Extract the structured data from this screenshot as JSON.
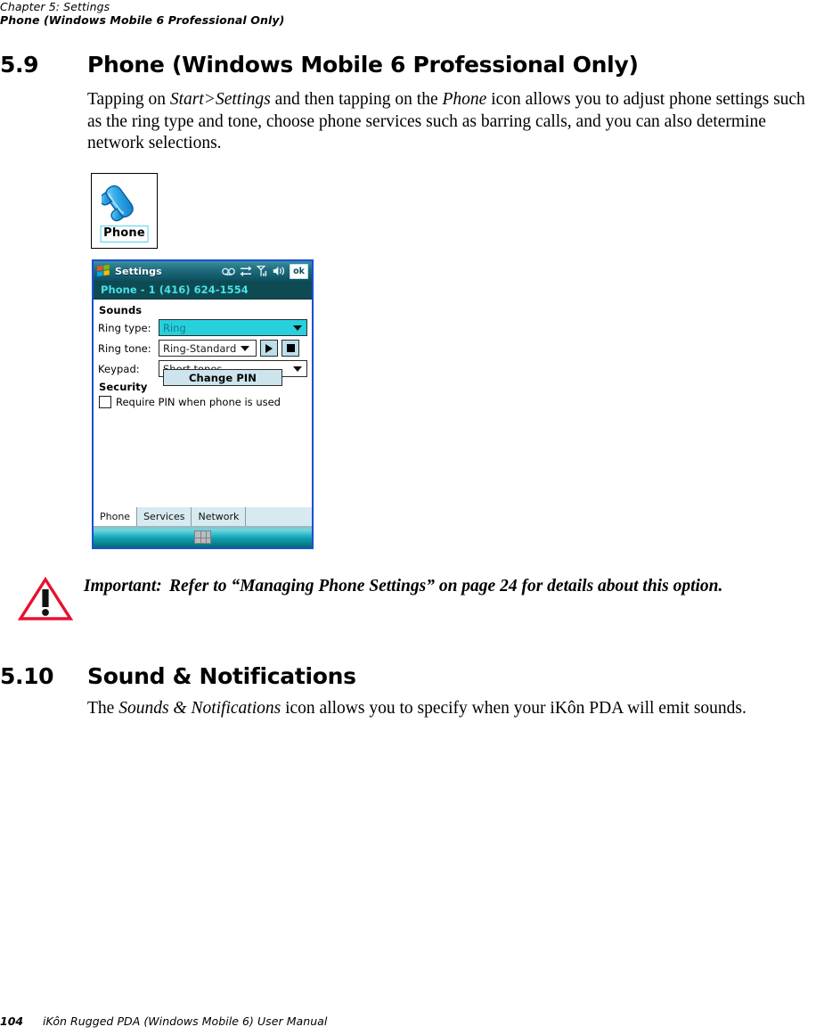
{
  "running_head": {
    "line1": "Chapter 5:  Settings",
    "line2": "Phone (Windows Mobile 6 Professional Only)"
  },
  "sections": [
    {
      "number": "5.9",
      "title": "Phone (Windows Mobile 6 Professional Only)",
      "paragraph_plain": "Tapping on Start>Settings and then tapping on the Phone icon allows you to adjust phone settings such as the ring type and tone, choose phone services such as barring calls, and you can also determine network selections.",
      "paragraph_parts": {
        "p1": "Tapping on ",
        "em1": "Start>Settings",
        "p2": " and then tapping on the ",
        "em2": "Phone",
        "p3": " icon allows you to adjust phone settings such as the ring type and tone, choose phone services such as barring calls, and you can also determine network selections."
      }
    },
    {
      "number": "5.10",
      "title": "Sound & Notifications",
      "paragraph_plain": "The Sounds & Notifications icon allows you to specify when your iKôn PDA will emit sounds.",
      "paragraph_parts": {
        "p1": "The ",
        "em1": "Sounds & Notifications",
        "p2": " icon allows you to specify when your iKôn PDA will emit sounds."
      }
    }
  ],
  "phone_icon_figure": {
    "icon": "phone-handset-icon",
    "caption": "Phone",
    "caption_border_color": "#4fd4e8",
    "handset_color": "#2aa8e0"
  },
  "pda_screenshot": {
    "frame_border_color": "#1a4fd6",
    "titlebar": {
      "start_icon": "windows-flag-icon",
      "title": "Settings",
      "status_icons": [
        "voicemail-icon",
        "connectivity-icon",
        "signal-bars-icon",
        "speaker-icon"
      ],
      "ok_label": "ok",
      "bg_color": "#1e6b7d"
    },
    "subbar": {
      "text": "Phone - 1 (416) 624-1554",
      "text_color": "#4ae0e8",
      "bg_color": "#0e4a52"
    },
    "groups": [
      {
        "label": "Sounds",
        "fields": [
          {
            "label": "Ring type:",
            "value": "Ring",
            "control": "combobox",
            "selected": true
          },
          {
            "label": "Ring tone:",
            "value": "Ring-Standard",
            "control": "combobox",
            "selected": false,
            "buttons": [
              {
                "name": "play-button",
                "glyph": "play-icon"
              },
              {
                "name": "stop-button",
                "glyph": "stop-icon"
              }
            ]
          },
          {
            "label": "Keypad:",
            "value": "Short tones",
            "control": "combobox",
            "selected": false
          }
        ]
      },
      {
        "label": "Security",
        "checkbox": {
          "label": "Require PIN when phone is used",
          "checked": false
        },
        "button": {
          "label": "Change PIN"
        }
      }
    ],
    "tabs": [
      {
        "label": "Phone",
        "active": true
      },
      {
        "label": "Services",
        "active": false
      },
      {
        "label": "Network",
        "active": false
      }
    ],
    "taskbar": {
      "icon": "keyboard-icon"
    }
  },
  "important_note": {
    "icon": "warning-triangle-icon",
    "icon_color": "#e8112d",
    "lead": "Important:",
    "text": "Refer to “Managing Phone Settings” on page 24 for details about this option."
  },
  "footer": {
    "page_number": "104",
    "title": "iKôn Rugged PDA (Windows Mobile 6) User Manual"
  }
}
